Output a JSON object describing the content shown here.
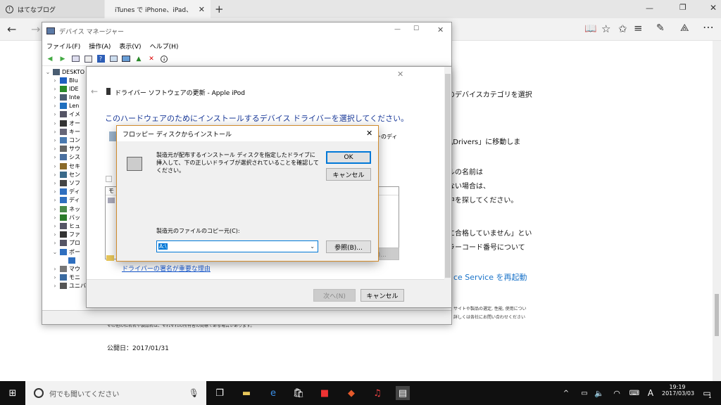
{
  "browser": {
    "tabs": [
      {
        "label": "はてなブログ"
      },
      {
        "label": "iTunes で iPhone、iPad、"
      }
    ],
    "new_tab": "+",
    "article": {
      "lines": [
        "のデバイスカテゴリを選択",
        "t\\Drivers」に移動しま",
        "ルの名前は",
        "ない場合は、",
        "中を探してください。",
        "に合格していません」とい",
        "ラーコード番号について"
      ],
      "link": "ce Service を再起動",
      "small_right": [
        "サイトや製品の選定, 性能, 使用につい",
        "詳しくは各社にお問い合わせください"
      ],
      "small_left": "その他の社名名や製品名は、それぞれの所有者の商標である場合があります。",
      "published": "公開日：2017/01/31"
    }
  },
  "device_manager": {
    "title": "デバイス マネージャー",
    "menu": [
      "ファイル(F)",
      "操作(A)",
      "表示(V)",
      "ヘルプ(H)"
    ],
    "root": "DESKTO",
    "tree": [
      "Blu",
      "IDE",
      "Inte",
      "Len",
      "イメ",
      "オー",
      "キー",
      "コン",
      "サウ",
      "シス",
      "セキ",
      "セン",
      "ソフ",
      "ディ",
      "ディ",
      "ネッ",
      "バッ",
      "ヒュ",
      "ファ",
      "プロ",
      "ポー",
      "",
      "マウ",
      "モニ",
      "ユニバーサル シリアル バス コントローラー"
    ]
  },
  "wizard": {
    "title": "ドライバー ソフトウェアの更新 - Apple iPod",
    "heading": "このハードウェアのためにインストールするデバイス ドライバーを選択してください。",
    "side_text": "ーのディ",
    "list_header": "モ",
    "disk_button": "ィスク(H)...",
    "signing_link": "ドライバーの署名が重要な理由",
    "next": "次へ(N)",
    "cancel": "キャンセル"
  },
  "floppy": {
    "title": "フロッピー ディスクからインストール",
    "message": "製造元が配布するインストール ディスクを指定したドライブに挿入して、下の正しいドライブが選択されていることを確認してください。",
    "ok": "OK",
    "cancel": "キャンセル",
    "copy_label": "製造元のファイルのコピー元(C):",
    "copy_value": "A:\\",
    "browse": "参照(B)..."
  },
  "taskbar": {
    "search_placeholder": "何でも聞いてください",
    "ime": "A",
    "time": "19:19",
    "date": "2017/03/03",
    "notifications": "1"
  }
}
